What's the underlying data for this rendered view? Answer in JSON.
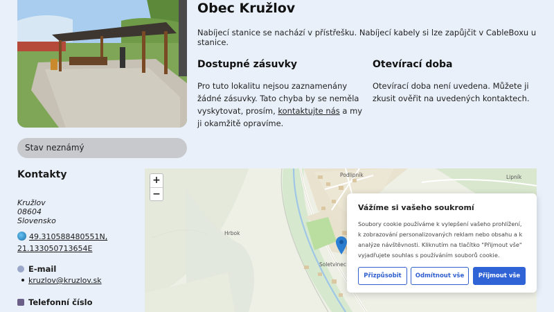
{
  "station": {
    "title": "Obec Kružlov",
    "intro": "Nabíjecí stanice se nachází v přístřešku. Nabíjecí kabely si lze zapůjčit v CableBoxu u stanice.",
    "status": "Stav neznámý"
  },
  "sockets": {
    "heading": "Dostupné zásuvky",
    "text_before": "Pro tuto lokalitu nejsou zaznamenány žádné zásuvky. Tato chyba by se neměla vyskytovat, prosím,",
    "link": "kontaktujte nás",
    "text_after": "a my ji okamžitě opravíme."
  },
  "hours": {
    "heading": "Otevírací doba",
    "text": "Otevírací doba není uvedena. Můžete ji zkusit ověřit na uvedených kontaktech."
  },
  "contacts": {
    "heading": "Kontakty",
    "address_line1": "Kružlov",
    "address_line2": "08604",
    "address_line3": "Slovensko",
    "coords_line1": "49.310588480551N,",
    "coords_line2": "21.133050713654E",
    "email_heading": "E-mail",
    "email": "kruzlov@kruzlov.sk",
    "phone_heading": "Telefonní číslo"
  },
  "map": {
    "zoom_in": "+",
    "zoom_out": "−",
    "places": {
      "podlipnik": "Podlipník",
      "lipnik": "Lipník",
      "hrbok": "Hrbok",
      "soletvinec": "Soletvinec"
    }
  },
  "cookie": {
    "heading": "Vážíme si vašeho soukromí",
    "text": "Soubory cookie používáme k vylepšení vašeho prohlížení, k zobrazování personalizovaných reklam nebo obsahu a k analýze návštěvnosti. Kliknutím na tlačítko \"Přijmout vše\" vyjadřujete souhlas s používáním souborů cookie.",
    "customize": "Přizpůsobit",
    "reject": "Odmítnout vše",
    "accept": "Přijmout vše"
  },
  "colors": {
    "page_bg": "#e9f0f9",
    "accent_blue": "#2f63d6",
    "status_pill": "#c7c9cc",
    "map_pin": "#2b7fd4"
  },
  "icons": {
    "coords": "globe-icon",
    "email": "email-icon",
    "phone": "phone-icon",
    "map_pin": "map-pin-icon"
  }
}
